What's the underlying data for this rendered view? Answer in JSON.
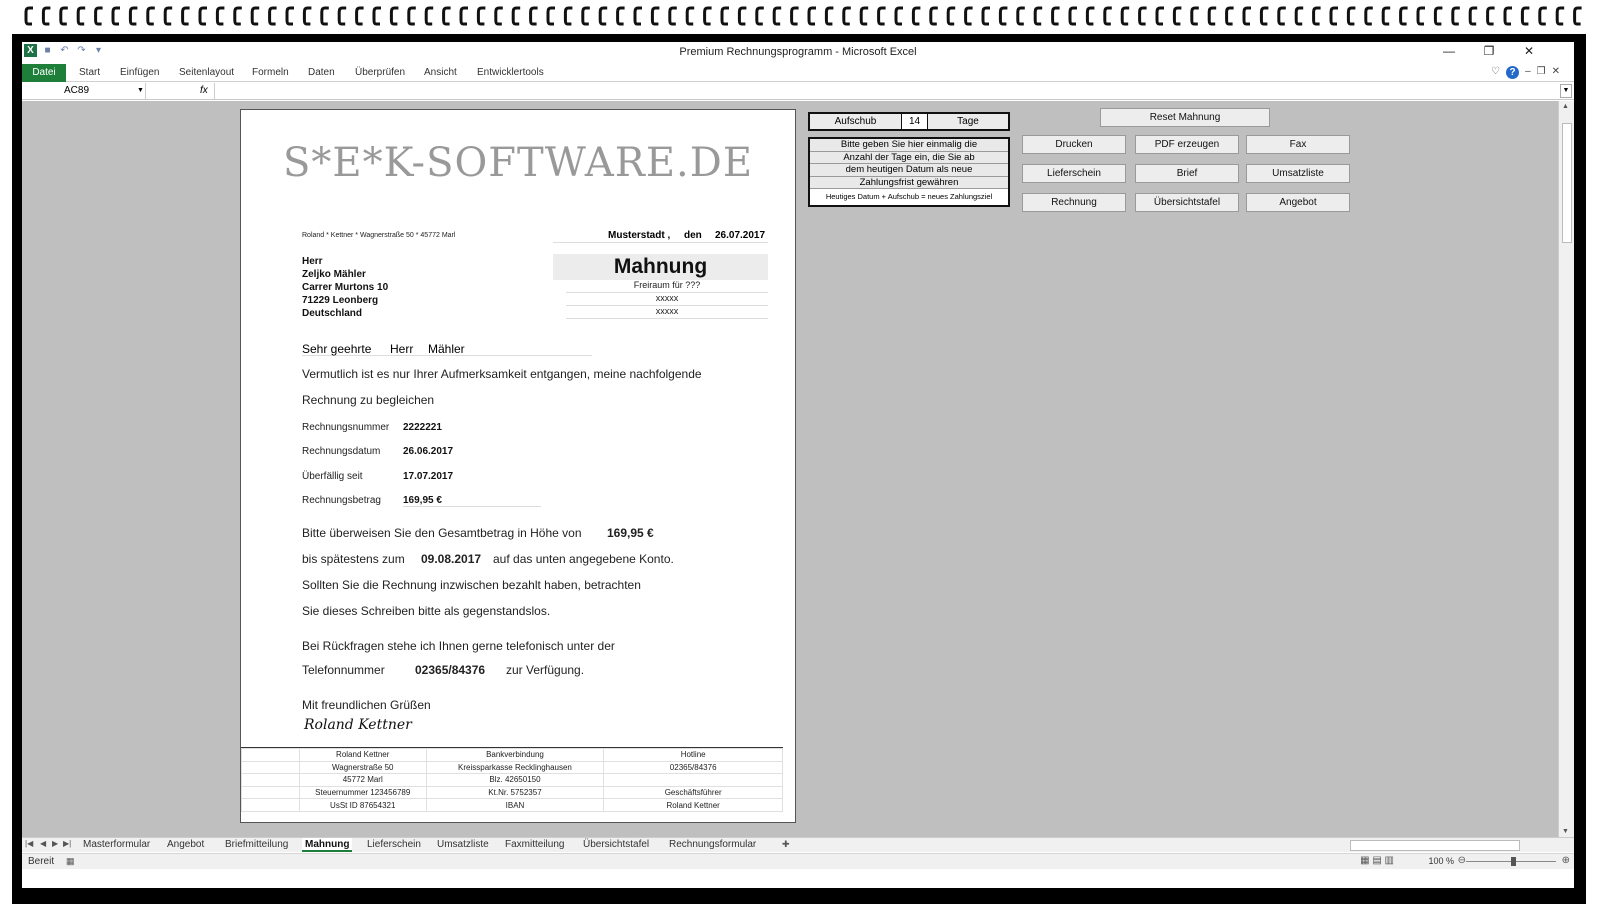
{
  "window": {
    "title": "Premium Rechnungsprogramm - Microsoft Excel",
    "controls": {
      "minimize": "—",
      "restore": "❐",
      "close": "✕"
    }
  },
  "ribbon": {
    "tabs": [
      "Datei",
      "Start",
      "Einfügen",
      "Seitenlayout",
      "Formeln",
      "Daten",
      "Überprüfen",
      "Ansicht",
      "Entwicklertools"
    ]
  },
  "formula_bar": {
    "name_box": "AC89",
    "fx": "fx",
    "value": ""
  },
  "letter": {
    "logo": "S*E*K-SOFTWARE.DE",
    "sender_line": "Roland * Kettner * Wagnerstraße 50 * 45772 Marl",
    "place": "Musterstadt ,",
    "den": "den",
    "date": "26.07.2017",
    "recipient": [
      "Herr",
      "Zeljko Mähler",
      "Carrer Murtons 10",
      "71229 Leonberg",
      "Deutschland"
    ],
    "title": "Mahnung",
    "free_lines": [
      "Freiraum für ???",
      "xxxxx",
      "xxxxx"
    ],
    "greeting": {
      "salutation": "Sehr geehrte",
      "title": "Herr",
      "name": "Mähler"
    },
    "intro": [
      "Vermutlich ist es nur Ihrer Aufmerksamkeit entgangen, meine nachfolgende",
      "Rechnung zu begleichen"
    ],
    "details": [
      {
        "label": "Rechnungsnummer",
        "value": "2222221"
      },
      {
        "label": "Rechnungsdatum",
        "value": "26.06.2017"
      },
      {
        "label": "Überfällig seit",
        "value": "17.07.2017"
      },
      {
        "label": "Rechnungsbetrag",
        "value": "169,95 €"
      }
    ],
    "pay_text_1": "Bitte überweisen Sie den Gesamtbetrag in Höhe von",
    "pay_amount": "169,95 €",
    "pay_text_2a": "bis spätestens zum",
    "pay_deadline": "09.08.2017",
    "pay_text_2b": "auf das unten angegebene Konto.",
    "paid_text": [
      "Sollten Sie die Rechnung inzwischen bezahlt haben, betrachten",
      "Sie dieses Schreiben bitte als gegenstandslos."
    ],
    "question_text": "Bei Rückfragen stehe ich Ihnen gerne telefonisch unter der",
    "phone_label": "Telefonnummer",
    "phone": "02365/84376",
    "phone_suffix": "zur Verfügung.",
    "closing": "Mit freundlichen Grüßen",
    "signature": "Roland Kettner",
    "footer": [
      [
        "Roland Kettner",
        "Bankverbindung",
        "Hotline"
      ],
      [
        "Wagnerstraße 50",
        "Kreissparkasse Recklinghausen",
        "02365/84376"
      ],
      [
        "45772 Marl",
        "Blz. 42650150",
        ""
      ],
      [
        "Steuernummer 123456789",
        "Kt.Nr. 5752357",
        "Geschäftsführer"
      ],
      [
        "UsSt ID 87654321",
        "IBAN",
        "Roland Kettner"
      ]
    ]
  },
  "controls": {
    "aufschub_label": "Aufschub",
    "aufschub_value": "14",
    "aufschub_unit": "Tage",
    "hint_lines": [
      "Bitte geben Sie hier einmalig die",
      "Anzahl der Tage ein, die Sie ab",
      "dem heutigen Datum als neue",
      "Zahlungsfrist gewähren"
    ],
    "hint_formula": "Heutiges Datum + Aufschub = neues Zahlungsziel",
    "reset": "Reset Mahnung",
    "buttons": [
      [
        "Drucken",
        "PDF erzeugen",
        "Fax"
      ],
      [
        "Lieferschein",
        "Brief",
        "Umsatzliste"
      ],
      [
        "Rechnung",
        "Übersichtstafel",
        "Angebot"
      ]
    ]
  },
  "sheet_tabs": [
    "Masterformular",
    "Angebot",
    "Briefmitteilung",
    "Mahnung",
    "Lieferschein",
    "Umsatzliste",
    "Faxmitteilung",
    "Übersichtstafel",
    "Rechnungsformular"
  ],
  "active_sheet": "Mahnung",
  "status": {
    "text": "Bereit",
    "zoom": "100 %"
  },
  "colors": {
    "excel_green": "#1e7f3b",
    "grid_background": "#bfbfbf"
  }
}
